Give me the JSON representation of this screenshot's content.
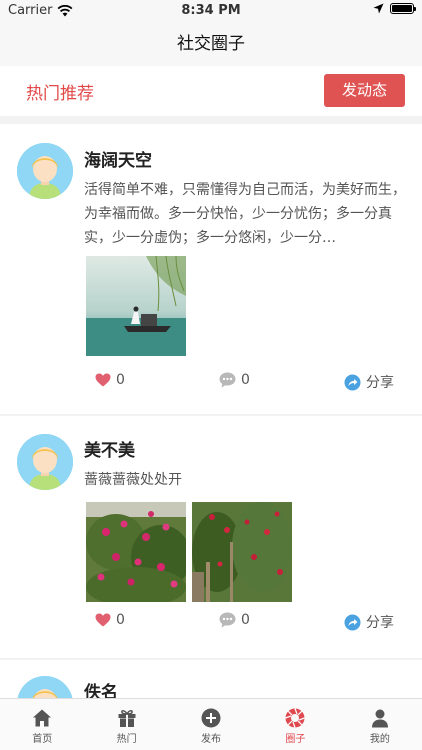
{
  "status": {
    "carrier": "Carrier",
    "time": "8:34 PM"
  },
  "nav": {
    "title": "社交圈子"
  },
  "header": {
    "section_title": "热门推荐",
    "post_button": "发动态"
  },
  "posts": [
    {
      "username": "海阔天空",
      "content": "活得简单不难，只需懂得为自己而活，为美好而生，为幸福而做。多一分快怡，少一分忧伤；多一分真实，少一分虚伪；多一分悠闲，少一分…",
      "likes": "0",
      "comments": "0",
      "share": "分享"
    },
    {
      "username": "美不美",
      "content": "蔷薇蔷薇处处开",
      "likes": "0",
      "comments": "0",
      "share": "分享"
    },
    {
      "username": "佚名"
    }
  ],
  "tabs": [
    {
      "label": "首页",
      "icon": "home-icon"
    },
    {
      "label": "热门",
      "icon": "gift-icon"
    },
    {
      "label": "发布",
      "icon": "plus-circle-icon"
    },
    {
      "label": "圈子",
      "icon": "aperture-icon",
      "active": true
    },
    {
      "label": "我的",
      "icon": "person-icon"
    }
  ],
  "colors": {
    "accent": "#e0484f",
    "like": "#e06070",
    "share": "#4aa3e0"
  }
}
